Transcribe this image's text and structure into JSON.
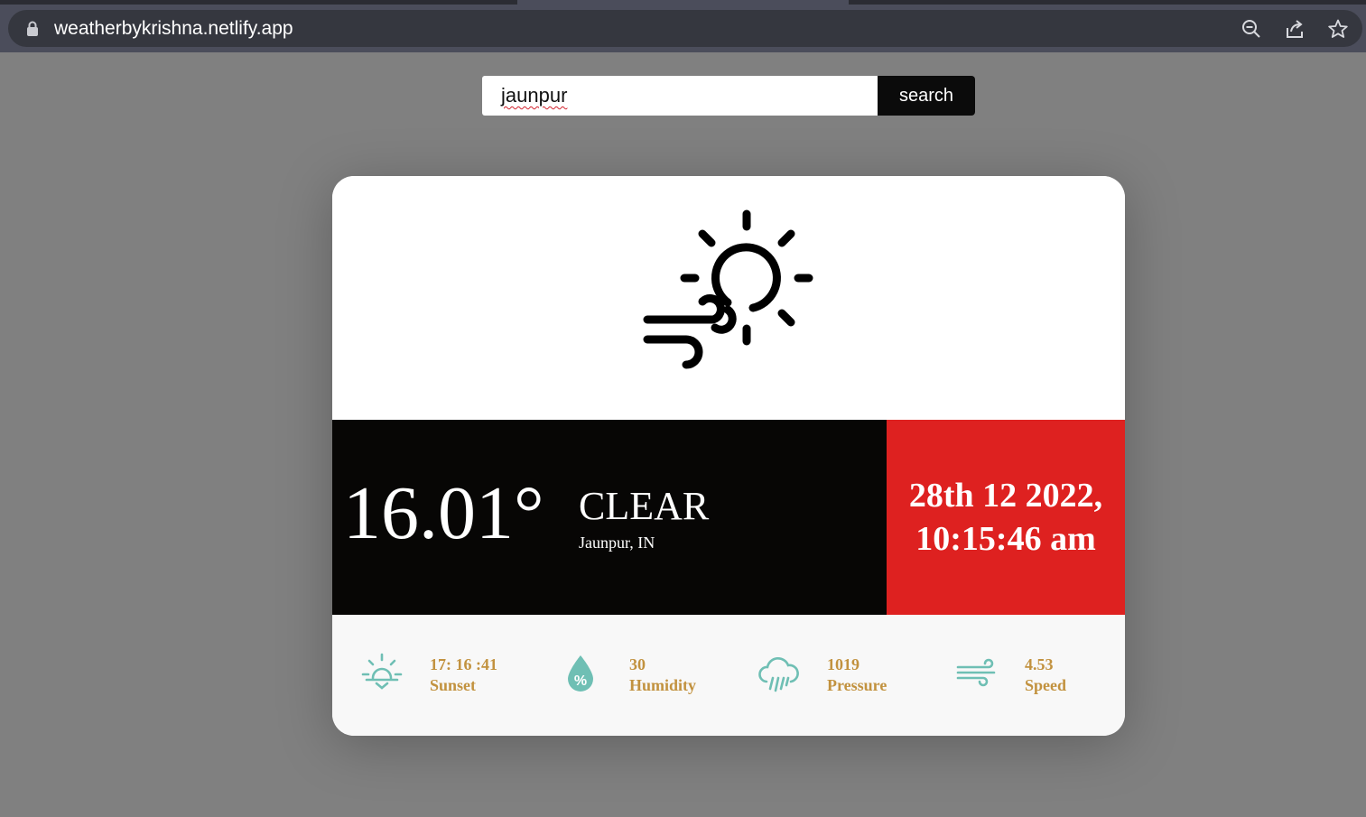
{
  "browser": {
    "url": "weatherbykrishna.netlify.app",
    "icons": [
      "lock-icon",
      "zoom-icon",
      "share-icon",
      "bookmark-star-icon"
    ]
  },
  "search": {
    "value": "jaunpur",
    "button_label": "search"
  },
  "weather": {
    "icon": "sun-wind-icon",
    "temperature": "16.01°",
    "condition": "CLEAR",
    "location": "Jaunpur, IN",
    "date_line": "28th 12 2022,",
    "time_line": "10:15:46 am"
  },
  "stats": [
    {
      "icon": "sunset-icon",
      "value": "17: 16 :41",
      "label": "Sunset"
    },
    {
      "icon": "humidity-icon",
      "value": "30",
      "label": "Humidity"
    },
    {
      "icon": "rain-cloud-icon",
      "value": "1019",
      "label": "Pressure"
    },
    {
      "icon": "wind-icon",
      "value": "4.53",
      "label": "Speed"
    }
  ],
  "colors": {
    "page_bg": "#808080",
    "band_dark": "#070605",
    "band_red": "#de2120",
    "stat_text": "#c2923f",
    "stat_icon": "#6fbfb4"
  }
}
